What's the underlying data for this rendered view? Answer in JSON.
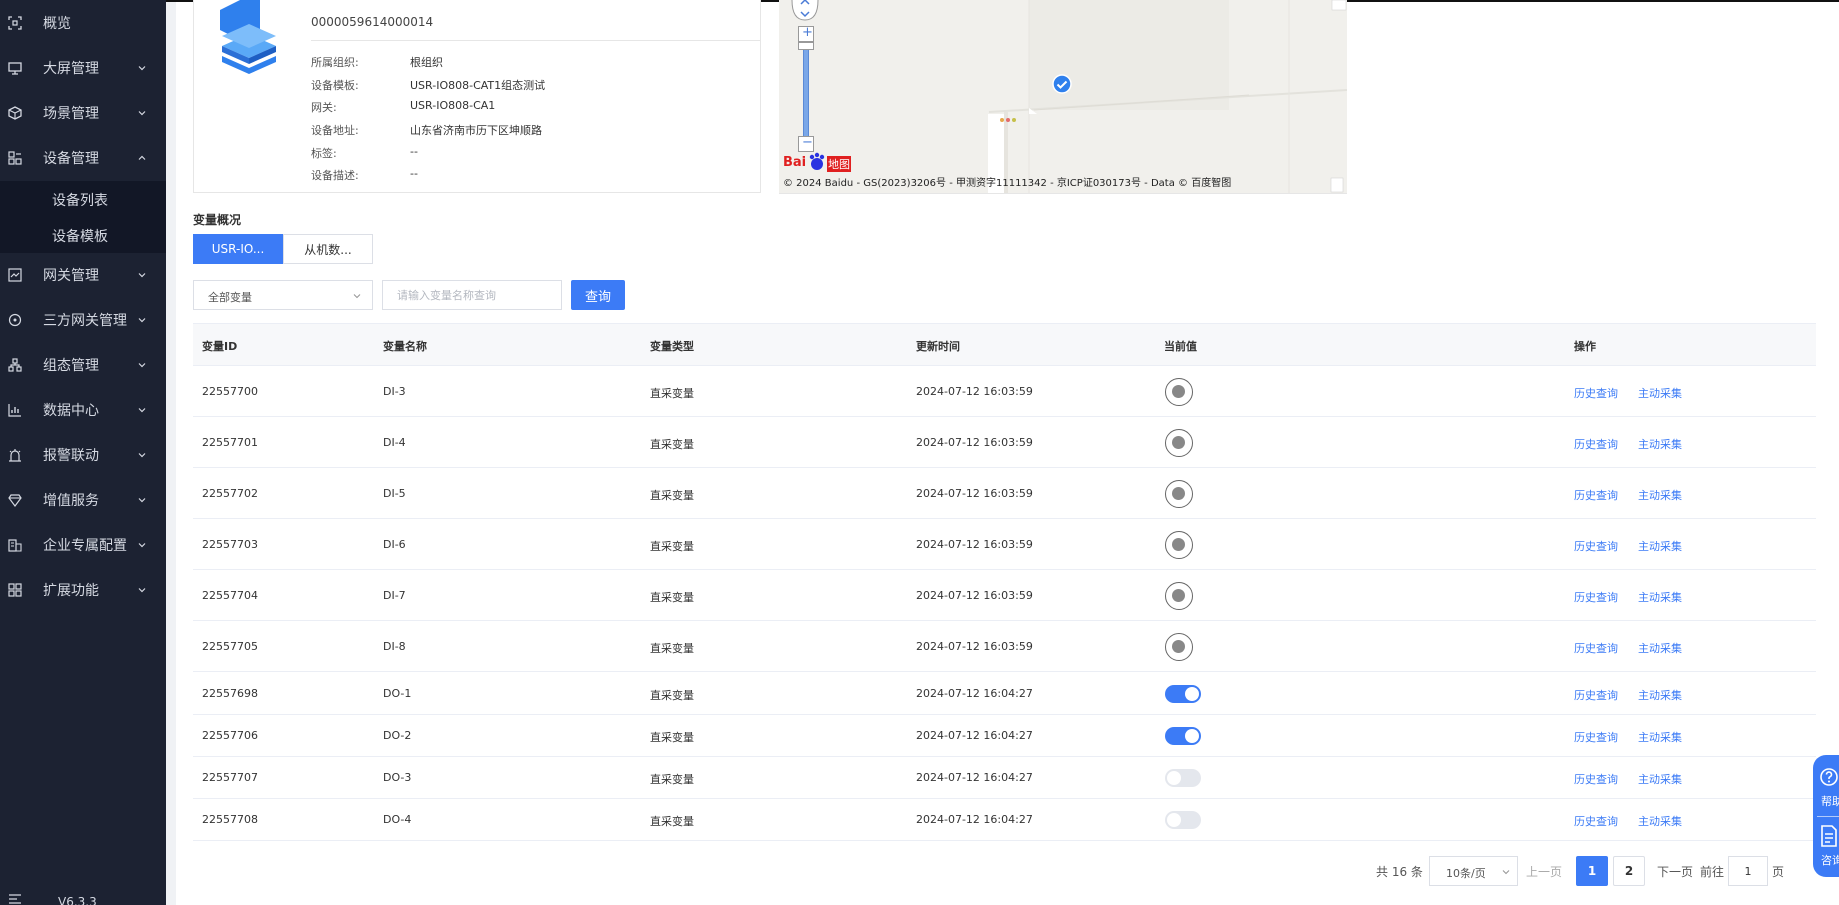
{
  "sidebar": {
    "items": [
      {
        "label": "概览"
      },
      {
        "label": "大屏管理"
      },
      {
        "label": "场景管理"
      },
      {
        "label": "设备管理"
      },
      {
        "label": "网关管理"
      },
      {
        "label": "三方网关管理"
      },
      {
        "label": "组态管理"
      },
      {
        "label": "数据中心"
      },
      {
        "label": "报警联动"
      },
      {
        "label": "增值服务"
      },
      {
        "label": "企业专属配置"
      },
      {
        "label": "扩展功能"
      }
    ],
    "sub_items": [
      {
        "label": "设备列表"
      },
      {
        "label": "设备模板"
      }
    ],
    "version": "V6.3.3"
  },
  "device": {
    "code": "0000059614000014",
    "fields": [
      {
        "label": "所属组织:",
        "value": "根组织"
      },
      {
        "label": "设备模板:",
        "value": "USR-IO808-CAT1组态测试"
      },
      {
        "label": "网关:",
        "value": "USR-IO808-CA1"
      },
      {
        "label": "设备地址:",
        "value": "山东省济南市历下区坤顺路"
      },
      {
        "label": "标签:",
        "value": "--"
      },
      {
        "label": "设备描述:",
        "value": "--"
      }
    ]
  },
  "map": {
    "copyright": "© 2024 Baidu - GS(2023)3206号 - 甲测资字11111342 - 京ICP证030173号 - Data © 百度智图",
    "logo_text": "Bai",
    "logo_text2": "地图",
    "zoom_in": "+",
    "zoom_out": "−"
  },
  "variables": {
    "section_title": "变量概况",
    "tabs": [
      {
        "label": "USR-IO...",
        "active": true
      },
      {
        "label": "从机数...",
        "active": false
      }
    ],
    "filter_select": "全部变量",
    "search_placeholder": "请输入变量名称查询",
    "query_button": "查询",
    "columns": [
      "变量ID",
      "变量名称",
      "变量类型",
      "更新时间",
      "当前值",
      "操作"
    ],
    "actions": {
      "history": "历史查询",
      "collect": "主动采集"
    },
    "rows": [
      {
        "id": "22557700",
        "name": "DI-3",
        "type": "直采变量",
        "time": "2024-07-12 16:03:59",
        "kind": "radio",
        "state": "off"
      },
      {
        "id": "22557701",
        "name": "DI-4",
        "type": "直采变量",
        "time": "2024-07-12 16:03:59",
        "kind": "radio",
        "state": "off"
      },
      {
        "id": "22557702",
        "name": "DI-5",
        "type": "直采变量",
        "time": "2024-07-12 16:03:59",
        "kind": "radio",
        "state": "off"
      },
      {
        "id": "22557703",
        "name": "DI-6",
        "type": "直采变量",
        "time": "2024-07-12 16:03:59",
        "kind": "radio",
        "state": "off"
      },
      {
        "id": "22557704",
        "name": "DI-7",
        "type": "直采变量",
        "time": "2024-07-12 16:03:59",
        "kind": "radio",
        "state": "off"
      },
      {
        "id": "22557705",
        "name": "DI-8",
        "type": "直采变量",
        "time": "2024-07-12 16:03:59",
        "kind": "radio",
        "state": "off"
      },
      {
        "id": "22557698",
        "name": "DO-1",
        "type": "直采变量",
        "time": "2024-07-12 16:04:27",
        "kind": "switch",
        "state": "on"
      },
      {
        "id": "22557706",
        "name": "DO-2",
        "type": "直采变量",
        "time": "2024-07-12 16:04:27",
        "kind": "switch",
        "state": "on"
      },
      {
        "id": "22557707",
        "name": "DO-3",
        "type": "直采变量",
        "time": "2024-07-12 16:04:27",
        "kind": "switch",
        "state": "off"
      },
      {
        "id": "22557708",
        "name": "DO-4",
        "type": "直采变量",
        "time": "2024-07-12 16:04:27",
        "kind": "switch",
        "state": "off"
      }
    ]
  },
  "pagination": {
    "total": "共 16 条",
    "page_size": "10条/页",
    "prev": "上一页",
    "pages": [
      "1",
      "2"
    ],
    "current": "1",
    "next": "下一页",
    "goto": "前往",
    "goto_value": "1",
    "page_unit": "页"
  },
  "float": {
    "help": "帮助",
    "consult": "咨询"
  },
  "colors": {
    "accent": "#3c7bf6",
    "sidebar_bg": "#1c2232"
  }
}
